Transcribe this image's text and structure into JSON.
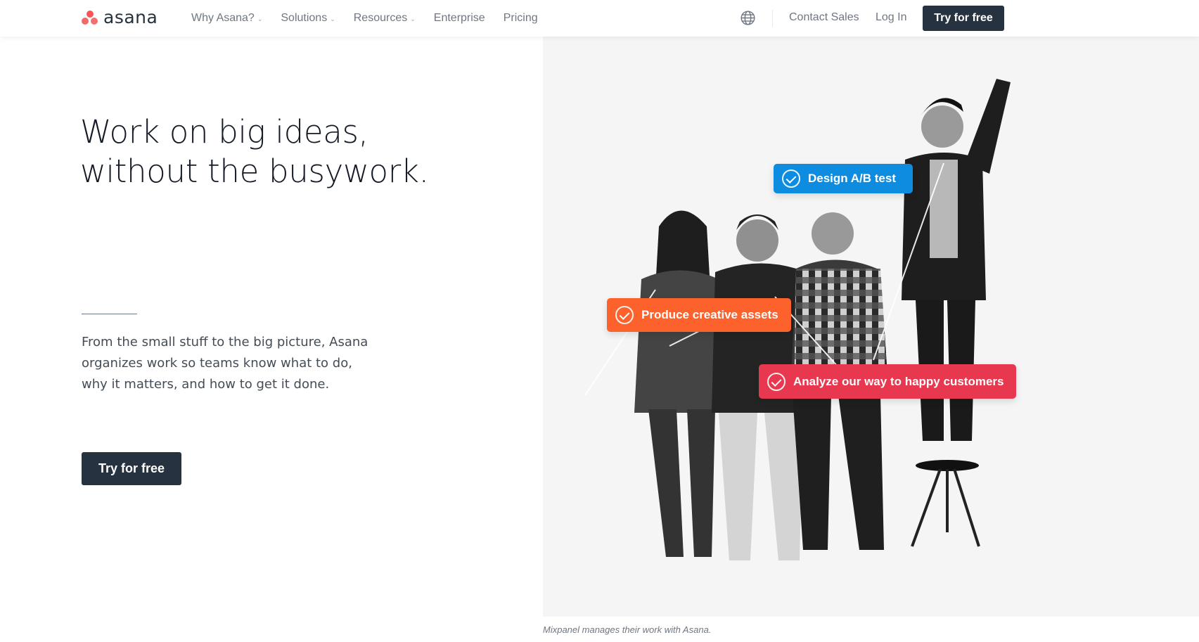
{
  "header": {
    "logo_text": "asana",
    "nav": [
      {
        "label": "Why Asana?",
        "has_dropdown": true
      },
      {
        "label": "Solutions",
        "has_dropdown": true
      },
      {
        "label": "Resources",
        "has_dropdown": true
      },
      {
        "label": "Enterprise",
        "has_dropdown": false
      },
      {
        "label": "Pricing",
        "has_dropdown": false
      }
    ],
    "language_icon": "globe-icon",
    "contact_sales": "Contact Sales",
    "log_in": "Log In",
    "cta": "Try for free"
  },
  "hero": {
    "title_lines": [
      "Work on big ideas,",
      "without the busywork."
    ],
    "description_lines": [
      "From the small stuff to the big picture, Asana",
      "organizes work so teams know what to do,",
      "why it matters, and how to get it done."
    ],
    "cta": "Try for free"
  },
  "visual": {
    "tags": [
      {
        "label": "Design A/B test",
        "color": "#0d8ce0",
        "icon": "check-circle-icon"
      },
      {
        "label": "Produce creative assets",
        "color": "#fd612c",
        "icon": "check-circle-icon"
      },
      {
        "label": "Analyze our way to happy customers",
        "color": "#e8384f",
        "icon": "check-circle-icon"
      }
    ],
    "caption": "Mixpanel manages their work with Asana."
  },
  "colors": {
    "brand_dark": "#273240",
    "logo_coral": "#f06a6a",
    "panel_bg": "#f5f5f5"
  }
}
